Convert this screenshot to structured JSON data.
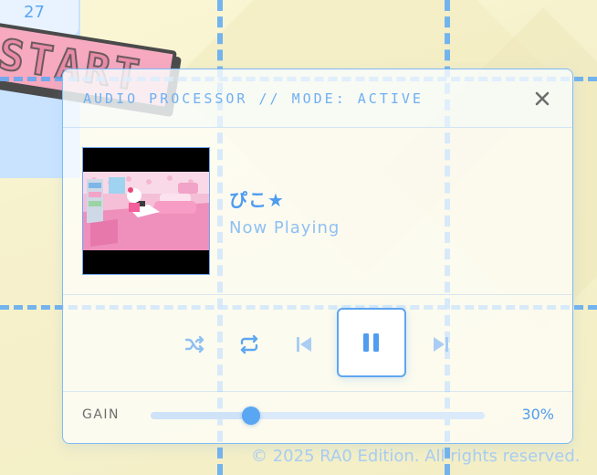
{
  "background": {
    "date_label": "27",
    "start_text": "START",
    "footer": "© 2025 RA0 Edition. All rights reserved."
  },
  "panel": {
    "title": "AUDIO PROCESSOR // MODE: ACTIVE",
    "close_icon": "close-icon",
    "track": {
      "name": "ぴこ★",
      "status": "Now Playing",
      "cover_icon": "album-cover-image"
    },
    "controls": {
      "shuffle_icon": "shuffle-icon",
      "repeat_icon": "repeat-icon",
      "prev_icon": "skip-previous-icon",
      "play_pause_icon": "pause-icon",
      "next_icon": "skip-next-icon"
    },
    "gain": {
      "label": "GAIN",
      "value": 0.3,
      "value_text": "30%"
    }
  },
  "colors": {
    "accent": "#4f9def",
    "accent_light": "#a9cdf4",
    "border": "#7fbaf3"
  }
}
